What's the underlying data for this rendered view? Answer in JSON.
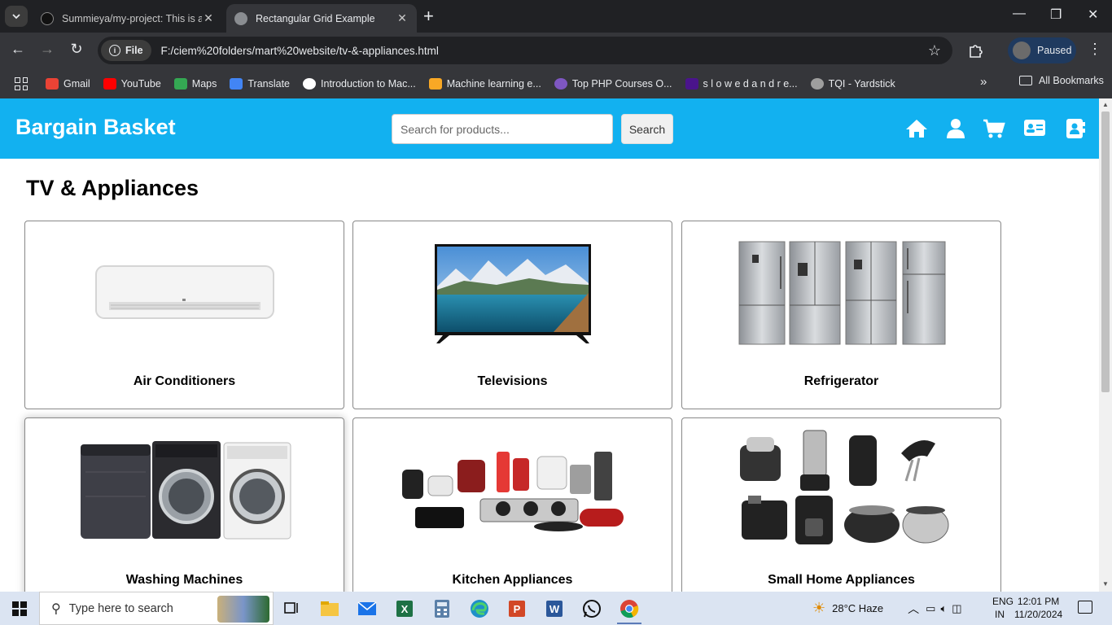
{
  "browser": {
    "tabs": [
      {
        "title": "Summieya/my-project: This is a",
        "active": false
      },
      {
        "title": "Rectangular Grid Example",
        "active": true
      }
    ],
    "file_chip": "File",
    "url": "F:/ciem%20folders/mart%20website/tv-&-appliances.html",
    "profile_label": "Paused",
    "bookmarks": [
      {
        "label": "Gmail",
        "color": "#ea4335"
      },
      {
        "label": "YouTube",
        "color": "#ff0000"
      },
      {
        "label": "Maps",
        "color": "#34a853"
      },
      {
        "label": "Translate",
        "color": "#4285f4"
      },
      {
        "label": "Introduction to Mac...",
        "color": "#ffffff"
      },
      {
        "label": "Machine learning e...",
        "color": "#f9a825"
      },
      {
        "label": "Top PHP Courses O...",
        "color": "#7e57c2"
      },
      {
        "label": "s l o w e d a n d r e...",
        "color": "#4a148c"
      },
      {
        "label": "TQI - Yardstick",
        "color": "#9e9e9e"
      }
    ],
    "all_bookmarks": "All Bookmarks"
  },
  "site": {
    "brand": "Bargain Basket",
    "search_placeholder": "Search for products...",
    "search_button": "Search",
    "nav_icons": [
      "home-icon",
      "user-icon",
      "cart-icon",
      "id-card-icon",
      "contact-icon"
    ],
    "accent": "#12b1f0"
  },
  "main": {
    "title": "TV & Appliances",
    "categories": [
      {
        "label": "Air Conditioners"
      },
      {
        "label": "Televisions"
      },
      {
        "label": "Refrigerator"
      },
      {
        "label": "Washing Machines"
      },
      {
        "label": "Kitchen Appliances"
      },
      {
        "label": "Small Home Appliances"
      }
    ]
  },
  "taskbar": {
    "search_placeholder": "Type here to search",
    "weather": "28°C  Haze",
    "lang_top": "ENG",
    "lang_bottom": "IN",
    "time": "12:01 PM",
    "date": "11/20/2024"
  }
}
